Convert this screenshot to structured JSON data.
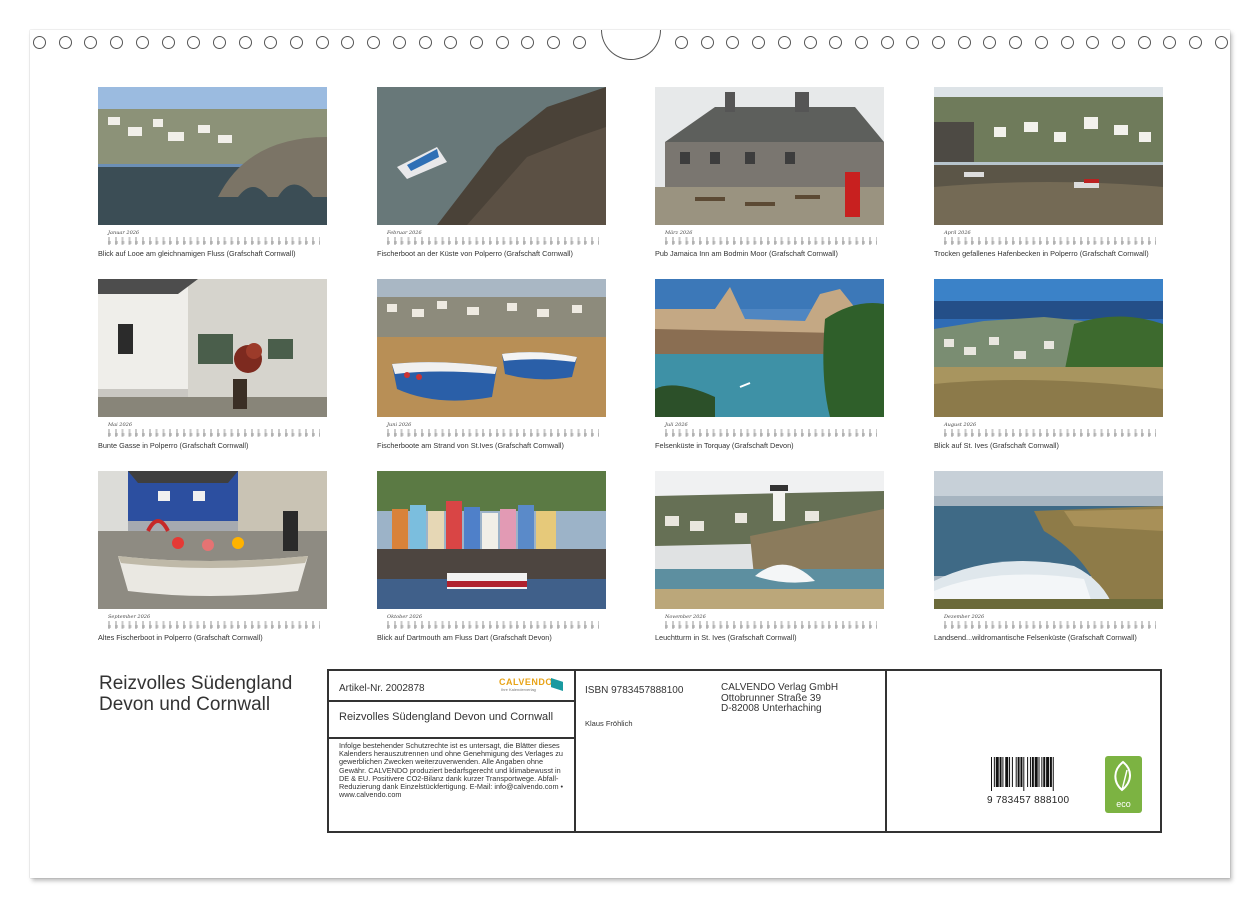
{
  "calendar": {
    "title": "Reizvolles Südengland Devon und Cornwall",
    "months": [
      {
        "name": "Januar 2026",
        "caption": "Blick auf Looe am gleichnamigen Fluss (Grafschaft Cornwall)"
      },
      {
        "name": "Februar 2026",
        "caption": "Fischerboot an der Küste von Polperro (Grafschaft Cornwall)"
      },
      {
        "name": "März 2026",
        "caption": "Pub Jamaica Inn am Bodmin Moor (Grafschaft Cornwall)"
      },
      {
        "name": "April 2026",
        "caption": "Trocken gefallenes Hafenbecken in Polperro (Grafschaft Cornwall)"
      },
      {
        "name": "Mai 2026",
        "caption": "Bunte Gasse in Polperro (Grafschaft Cornwall)"
      },
      {
        "name": "Juni 2026",
        "caption": "Fischerboote am Strand von St.Ives (Grafschaft Cornwall)"
      },
      {
        "name": "Juli 2026",
        "caption": "Felsenküste in Torquay (Grafschaft Devon)"
      },
      {
        "name": "August 2026",
        "caption": "Blick auf St. Ives (Grafschaft Cornwall)"
      },
      {
        "name": "September 2026",
        "caption": "Altes Fischerboot in Polperro (Grafschaft Cornwall)"
      },
      {
        "name": "Oktober 2026",
        "caption": "Blick auf Dartmouth am Fluss Dart (Grafschaft Devon)"
      },
      {
        "name": "November 2026",
        "caption": "Leuchtturm in St. Ives (Grafschaft Cornwall)"
      },
      {
        "name": "Dezember 2026",
        "caption": "Landsend...wildromantische Felsenküste (Grafschaft Cornwall)"
      }
    ]
  },
  "info": {
    "article_no": "Artikel-Nr. 2002878",
    "logo_text": "CALVENDO",
    "logo_sub": "Ihre Kalenderverlag",
    "product_title": "Reizvolles Südengland Devon und Cornwall",
    "legal_text": "Infolge bestehender Schutzrechte ist es untersagt, die Blätter dieses Kalenders herauszutrennen und ohne Genehmigung des Verlages zu gewerblichen Zwecken weiterzuverwenden. Alle Angaben ohne Gewähr. CALVENDO produziert bedarfsgerecht und klimabewusst in DE & EU. Positivere CO2-Bilanz dank kurzer Transportwege. Abfall-Reduzierung dank Einzelstückfertigung. E-Mail: info@calvendo.com • www.calvendo.com",
    "isbn": "ISBN 9783457888100",
    "author": "Klaus Fröhlich",
    "publisher_name": "CALVENDO Verlag GmbH",
    "publisher_street": "Ottobrunner Straße 39",
    "publisher_city": "D-82008 Unterhaching",
    "barcode_digits": "9 783457 888100",
    "eco_label": "eco"
  },
  "colors": {
    "eco_green": "#7cb342",
    "logo_teal": "#1a9aa0",
    "logo_orange": "#e8a317"
  }
}
